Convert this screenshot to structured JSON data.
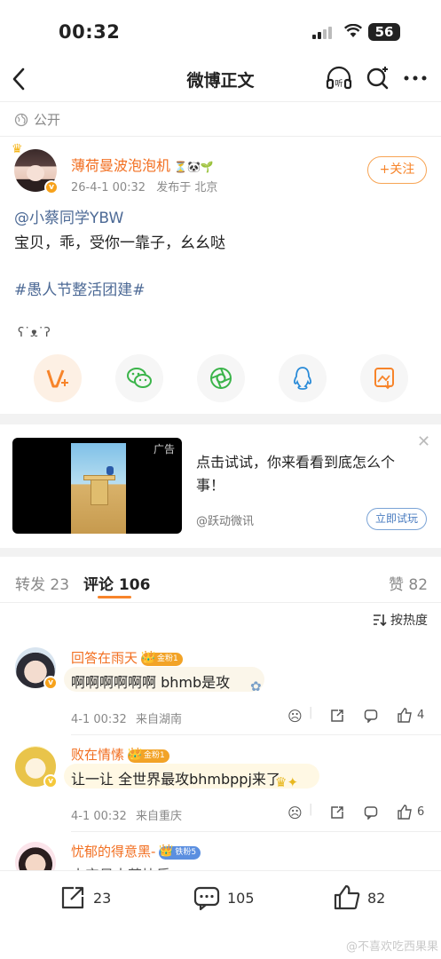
{
  "status_bar": {
    "time": "00:32",
    "battery": "56"
  },
  "nav": {
    "title": "微博正文"
  },
  "post": {
    "visibility": "公开",
    "author": {
      "name": "薄荷曼波泡泡机",
      "name_emojis": "⏳🐼🌱",
      "date": "26-4-1 00:32",
      "location": "发布于 北京"
    },
    "follow_label": "+关注",
    "mention": "@小蔡同学YBW",
    "text": "宝贝，乖，受你一靠子，幺幺哒",
    "hashtag": "#愚人节整活团建#",
    "emoticon": "ʕ˙ᴥ˙ʔ"
  },
  "share_icons": [
    "vplus-icon",
    "wechat-icon",
    "moments-icon",
    "qq-icon",
    "save-image-icon"
  ],
  "ad": {
    "label": "广告",
    "title": "点击试试，你来看看到底怎么个事！",
    "source": "@跃动微讯",
    "cta": "立即试玩"
  },
  "tabs": [
    {
      "label": "转发 23"
    },
    {
      "label": "评论 106"
    },
    {
      "label": "赞 82"
    }
  ],
  "sort_label": "按热度",
  "comments": [
    {
      "name": "回答在雨天",
      "badge": "金粉1",
      "text": "啊啊啊啊啊啊 bhmb是攻",
      "time": "4-1 00:32",
      "location": "来自湖南",
      "likes": "4"
    },
    {
      "name": "败在情愫",
      "badge": "金粉1",
      "text": "让一让 全世界最攻bhmbppj来了",
      "time": "4-1 00:32",
      "location": "来自重庆",
      "likes": "6"
    },
    {
      "name": "忧郁的得意黑-",
      "badge": "铁粉5",
      "text": "小宝贝大营块乐",
      "time": "",
      "location": "",
      "likes": ""
    }
  ],
  "bottom_bar": {
    "reposts": "23",
    "comments": "105",
    "likes": "82"
  },
  "watermark": "@不喜欢吃西果果",
  "colors": {
    "accent": "#f7842a",
    "name": "#f26f21",
    "link": "#4d6a96"
  }
}
